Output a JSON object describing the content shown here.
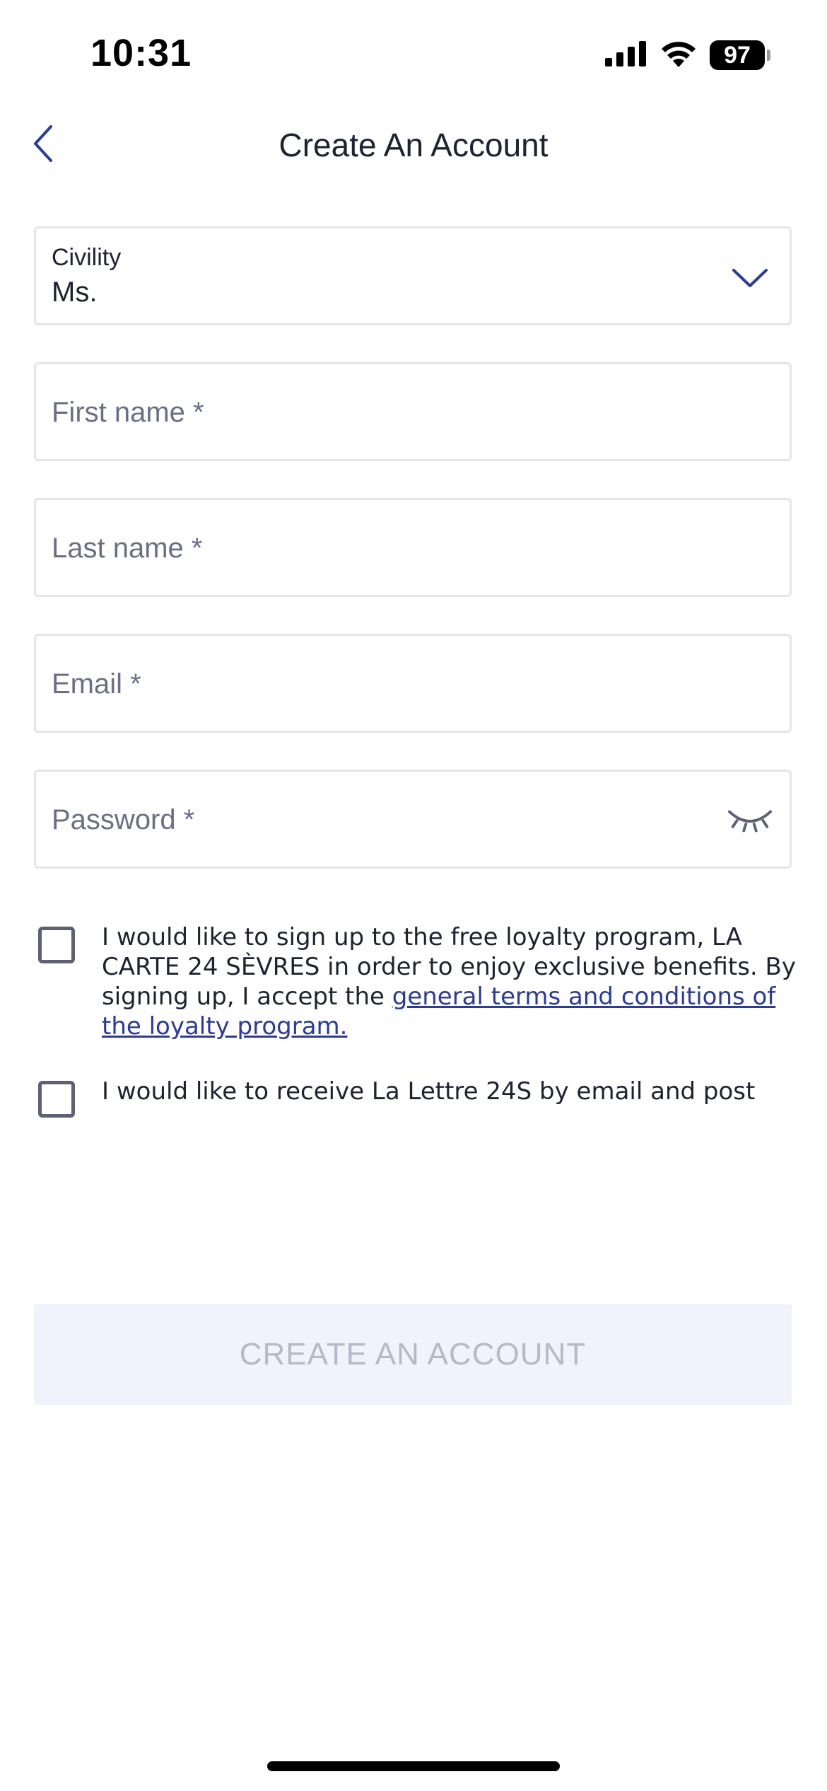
{
  "status_bar": {
    "time": "10:31",
    "battery": "97",
    "icons": [
      "cellular-signal-icon",
      "wifi-icon",
      "battery-icon"
    ]
  },
  "header": {
    "title": "Create An Account",
    "back_icon": "chevron-left-icon"
  },
  "form": {
    "civility": {
      "label": "Civility",
      "value": "Ms.",
      "icon": "chevron-down-icon"
    },
    "first_name": {
      "placeholder": "First name *"
    },
    "last_name": {
      "placeholder": "Last name *"
    },
    "email": {
      "placeholder": "Email *"
    },
    "password": {
      "placeholder": "Password *",
      "icon": "eye-closed-icon"
    },
    "loyalty_checkbox": {
      "text": "I would like to sign up to the free loyalty program, LA CARTE 24 SÈVRES in order to enjoy exclusive benefits. By signing up, I accept the ",
      "link": "general terms and conditions of the loyalty program.",
      "checked": false
    },
    "newsletter_checkbox": {
      "text": "I would like to receive La Lettre 24S by email and post",
      "checked": false
    },
    "submit_label": "CREATE AN ACCOUNT"
  },
  "colors": {
    "accent": "#2a3a9e",
    "placeholder": "#6b6e85",
    "border": "#e4e5ea",
    "button_disabled_bg": "#f1f2fb",
    "button_disabled_text": "#b8b9c8"
  }
}
